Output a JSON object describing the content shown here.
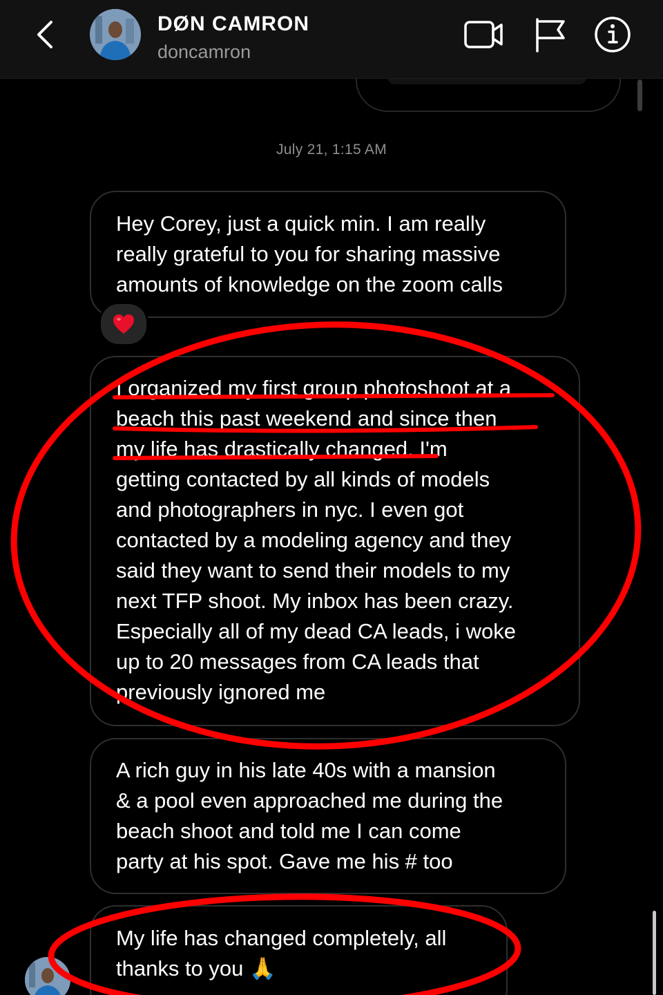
{
  "header": {
    "contact_name": "DØN CAMRON",
    "username": "doncamron",
    "icons": {
      "back": "chevron-left-icon",
      "video": "video-call-icon",
      "flag": "flag-icon",
      "info": "info-icon"
    }
  },
  "thread": {
    "timestamp": "July 21, 1:15 AM",
    "messages": [
      {
        "text": "Hey Corey, just a quick min. I am really\nreally grateful to you for sharing massive\namounts of knowledge on the zoom calls",
        "reaction": "❤️"
      },
      {
        "text": "I organized my first group photoshoot at a\nbeach this past weekend and since then\nmy life has drastically changed. I'm\ngetting contacted by all kinds of models\nand photographers in nyc. I even got\ncontacted by a modeling agency and they\nsaid they want to send their models to my\nnext TFP shoot. My inbox has been crazy.\nEspecially all of my dead CA leads, i woke\nup to 20 messages from CA leads that\npreviously ignored me"
      },
      {
        "text": "A rich guy in his late 40s with a mansion\n& a pool even approached me during the\nbeach shoot and told me I can come\nparty at his spot. Gave me his # too"
      },
      {
        "text": "My life has changed completely, all\nthanks to you 🙏"
      }
    ]
  },
  "colors": {
    "background": "#000000",
    "header": "#121212",
    "bubble_border": "#2e2e2e",
    "annotation_red": "#ff0000",
    "secondary_text": "#8e8e8e"
  }
}
